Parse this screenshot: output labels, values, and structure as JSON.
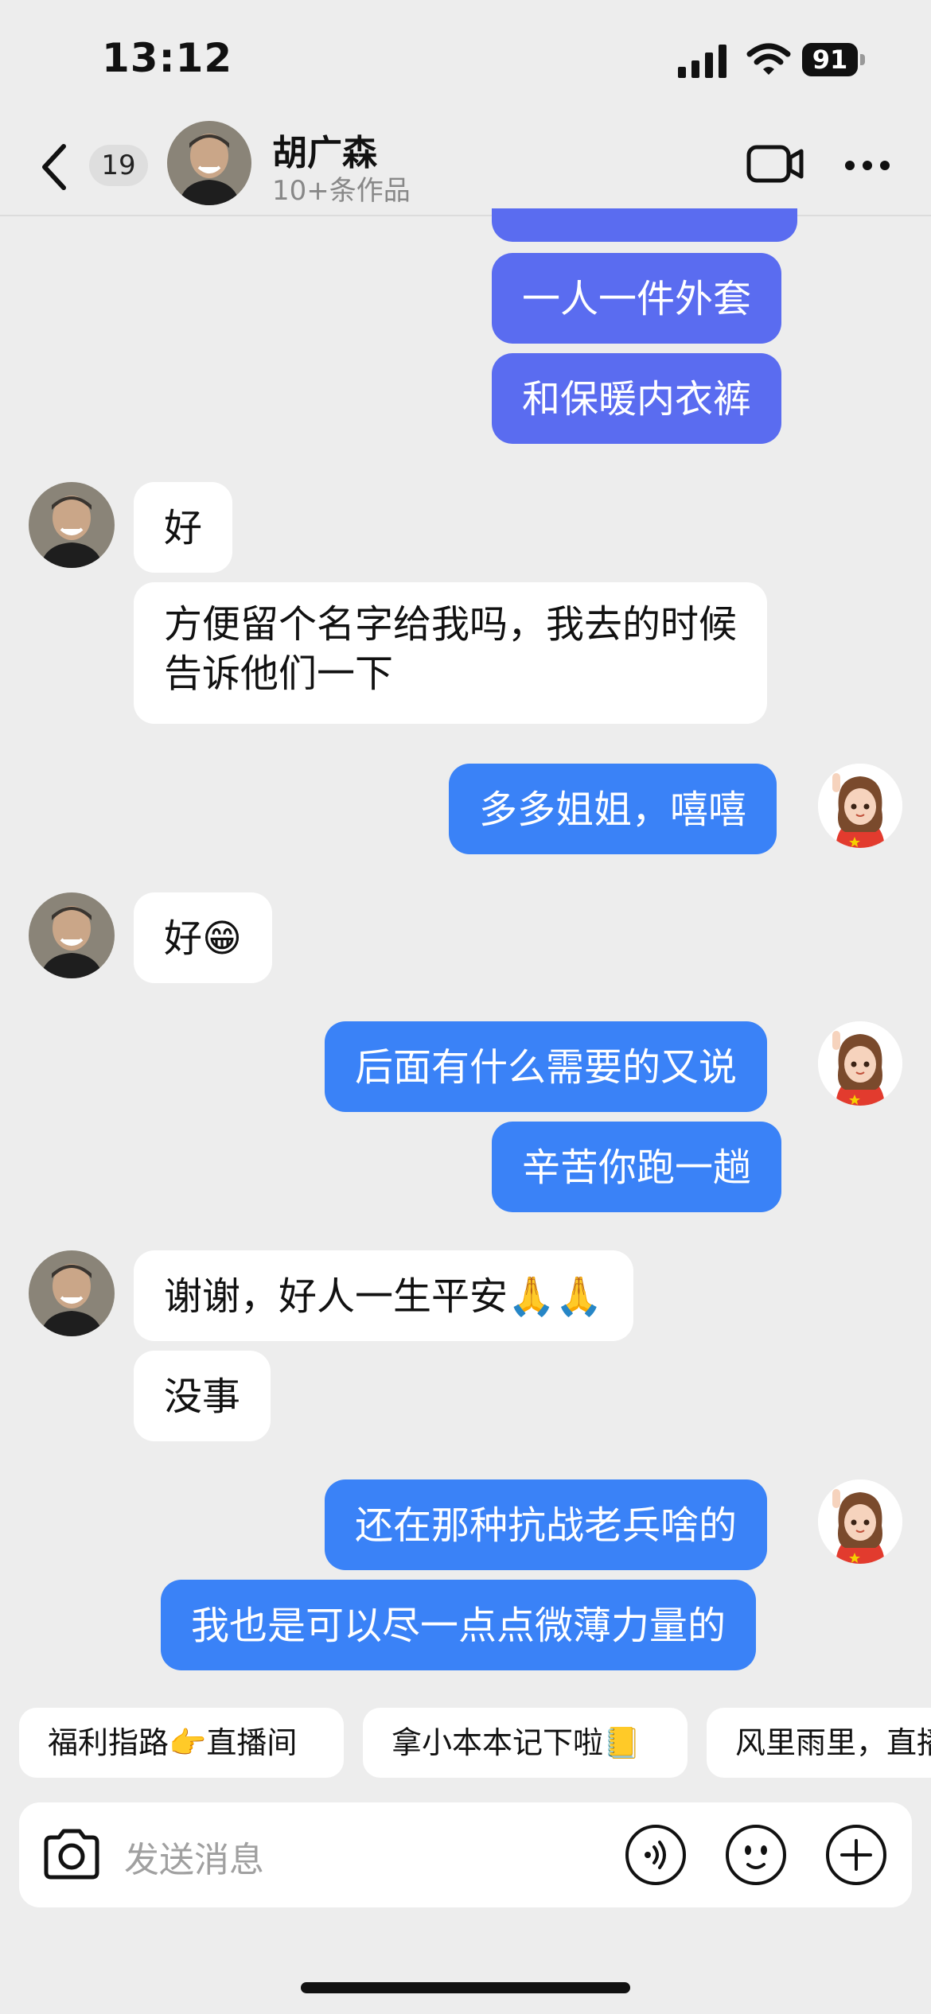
{
  "status_bar": {
    "time": "13:12",
    "battery": "91"
  },
  "header": {
    "back_badge": "19",
    "contact_name": "胡广森",
    "contact_sub": "10+条作品"
  },
  "messages": [
    {
      "side": "out",
      "text": "一人一件外套"
    },
    {
      "side": "out",
      "text": "和保暖内衣裤"
    },
    {
      "side": "in",
      "text": "好"
    },
    {
      "side": "in",
      "line1": "方便留个名字给我吗，我去的时候",
      "line2": "告诉他们一下"
    },
    {
      "side": "out",
      "text": "多多姐姐，嘻嘻"
    },
    {
      "side": "in",
      "text": "好😁"
    },
    {
      "side": "out",
      "text": "后面有什么需要的又说"
    },
    {
      "side": "out",
      "text": "辛苦你跑一趟"
    },
    {
      "side": "in",
      "text": "谢谢，好人一生平安🙏🙏"
    },
    {
      "side": "in",
      "text": "没事"
    },
    {
      "side": "out",
      "text": "还在那种抗战老兵啥的"
    },
    {
      "side": "out",
      "text": "我也是可以尽一点点微薄力量的"
    }
  ],
  "quick_replies": [
    "福利指路👉直播间",
    "拿小本本记下啦📒",
    "风里雨里，直播"
  ],
  "input": {
    "placeholder": "发送消息"
  },
  "colors": {
    "out_bubble": "#3a82f7",
    "out_bubble_older": "#5a6cf0",
    "in_bubble": "#ffffff",
    "background": "#ededed"
  }
}
